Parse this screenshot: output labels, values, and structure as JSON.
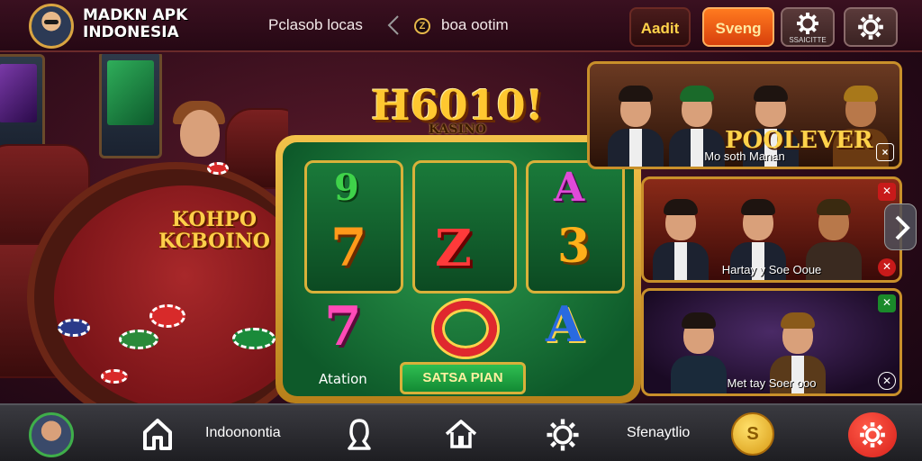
{
  "header": {
    "brand_title": "MADKN APK INDONESIA",
    "link_1": "Pclasob locas",
    "link_2": "boa ootim",
    "coin_symbol": "Z",
    "btn_add": "Aadit",
    "btn_bet": "Sveng",
    "btn_icon_caption": "SSAICITTE"
  },
  "scene": {
    "table_title": "KOHPO KCBOINO"
  },
  "slot": {
    "logo_main": "H6010!",
    "logo_sub": "KASINO",
    "reels": [
      [
        "9",
        "7"
      ],
      [
        "Z"
      ],
      [
        "A",
        "3"
      ]
    ],
    "bottom_symbols": [
      "7",
      "A"
    ],
    "label": "Atation",
    "button": "SATSA PIAN"
  },
  "cards": [
    {
      "headline": "POOLEVER",
      "caption": "Mo soth Manan"
    },
    {
      "caption": "Hartay y Soe Ooue"
    },
    {
      "caption": "Met tay Soer ooo"
    }
  ],
  "bottom_nav": {
    "item_1": "Indoonontia",
    "item_2": "Sfenaytlio",
    "coin_symbol": "S"
  },
  "colors": {
    "gold": "#ffc830",
    "felt_green": "#0e5a2a",
    "accent_orange": "#ff7a1f",
    "settings_red": "#d8201a"
  }
}
